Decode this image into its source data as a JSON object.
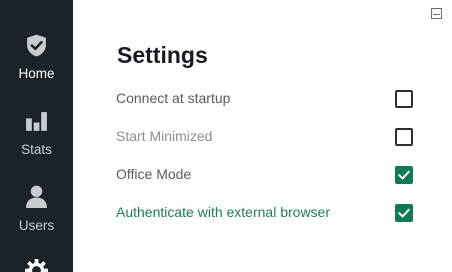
{
  "sidebar": {
    "items": [
      {
        "label": "Home",
        "icon": "shield-check-icon",
        "active": true
      },
      {
        "label": "Stats",
        "icon": "bar-chart-icon",
        "active": false
      },
      {
        "label": "Users",
        "icon": "user-icon",
        "active": false
      },
      {
        "label": "",
        "icon": "gear-icon",
        "active": false
      }
    ]
  },
  "window": {
    "minimize_icon": "minimize-icon"
  },
  "settings": {
    "title": "Settings",
    "options": [
      {
        "label": "Connect at startup",
        "checked": false
      },
      {
        "label": "Start Minimized",
        "checked": false
      },
      {
        "label": "Office Mode",
        "checked": true
      },
      {
        "label": "Authenticate with external browser",
        "checked": true
      }
    ]
  },
  "colors": {
    "sidebar_bg": "#1b2329",
    "accent_green": "#0f7a55",
    "link_green": "#1e7d56",
    "title": "#151b22"
  }
}
